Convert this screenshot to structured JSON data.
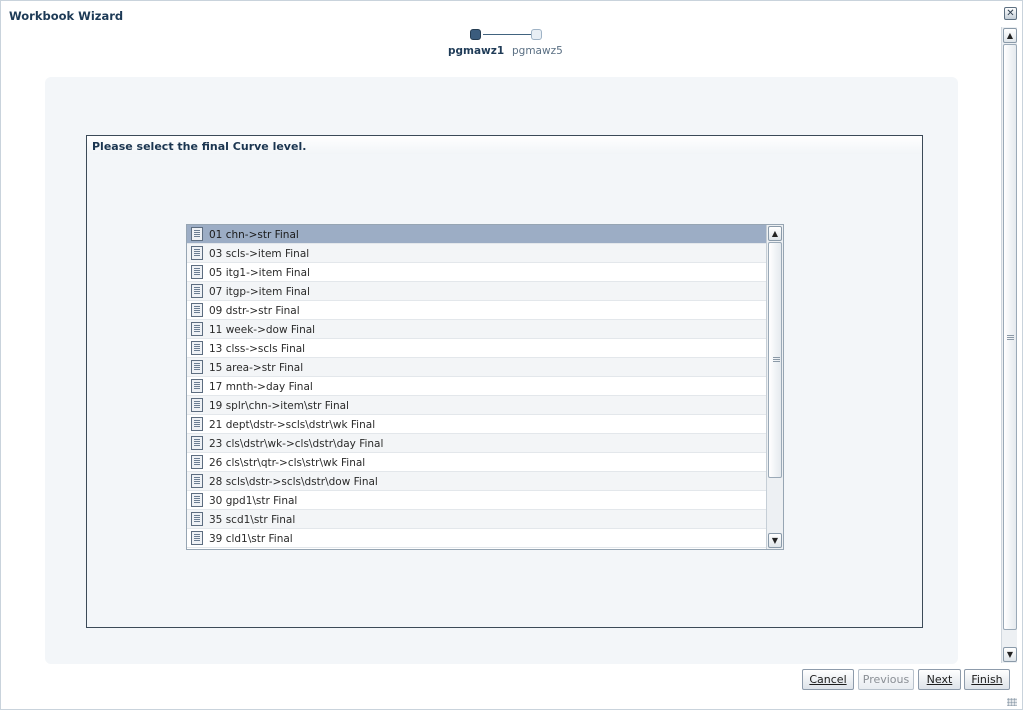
{
  "dialog": {
    "title": "Workbook Wizard"
  },
  "train": {
    "steps": [
      {
        "label": "pgmawz1",
        "state": "current"
      },
      {
        "label": "pgmawz5",
        "state": "next"
      }
    ]
  },
  "content": {
    "instruction": "Please select the final Curve level."
  },
  "list": {
    "selected_index": 0,
    "items": [
      "01 chn->str Final",
      "03 scls->item Final",
      "05 itg1->item Final",
      "07 itgp->item Final",
      "09 dstr->str Final",
      "11 week->dow Final",
      "13 clss->scls Final",
      "15 area->str Final",
      "17 mnth->day Final",
      "19 splr\\chn->item\\str Final",
      "21 dept\\dstr->scls\\dstr\\wk Final",
      "23 cls\\dstr\\wk->cls\\dstr\\day Final",
      "26 cls\\str\\qtr->cls\\str\\wk Final",
      "28 scls\\dstr->scls\\dstr\\dow Final",
      "30 gpd1\\str Final",
      "35 scd1\\str Final",
      "39 cld1\\str Final"
    ]
  },
  "footer": {
    "cancel": "Cancel",
    "previous": "Previous",
    "next": "Next",
    "finish": "Finish"
  },
  "colors": {
    "selection": "#9cadc5",
    "title_text": "#1d3a56"
  }
}
